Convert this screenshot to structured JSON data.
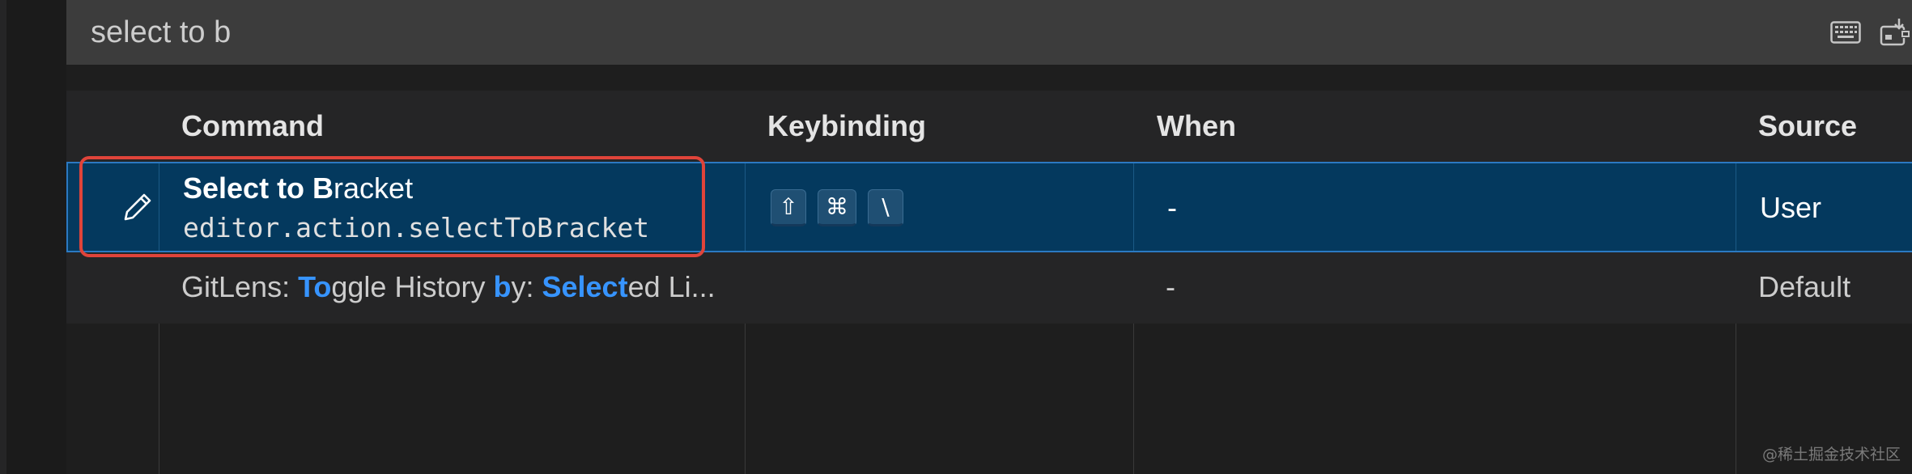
{
  "search": {
    "value": "select to b"
  },
  "toolbar": {
    "icons": [
      "keyboard-icon",
      "record-keys-icon"
    ]
  },
  "table": {
    "headers": {
      "command": "Command",
      "keybinding": "Keybinding",
      "when": "When",
      "source": "Source"
    },
    "rows": [
      {
        "title_match_1": "Select to B",
        "title_rest": "racket",
        "command_id": "editor.action.selectToBracket",
        "keys": [
          "⇧",
          "⌘",
          "\\"
        ],
        "when": "-",
        "source": "User",
        "icon": "edit-icon"
      },
      {
        "title_parts": [
          {
            "text": "GitLens: ",
            "match": false
          },
          {
            "text": "To",
            "match": true
          },
          {
            "text": "ggle History ",
            "match": false
          },
          {
            "text": "b",
            "match": true
          },
          {
            "text": "y: ",
            "match": false
          },
          {
            "text": "Select",
            "match": true
          },
          {
            "text": "ed Li...",
            "match": false
          }
        ],
        "when": "-",
        "source": "Default"
      }
    ]
  },
  "watermark": "@稀土掘金技术社区",
  "colors": {
    "selection_bg": "#04395e",
    "selection_border": "#2b79c2",
    "match_highlight": "#3794ff",
    "annotation_box": "#e0443a"
  }
}
